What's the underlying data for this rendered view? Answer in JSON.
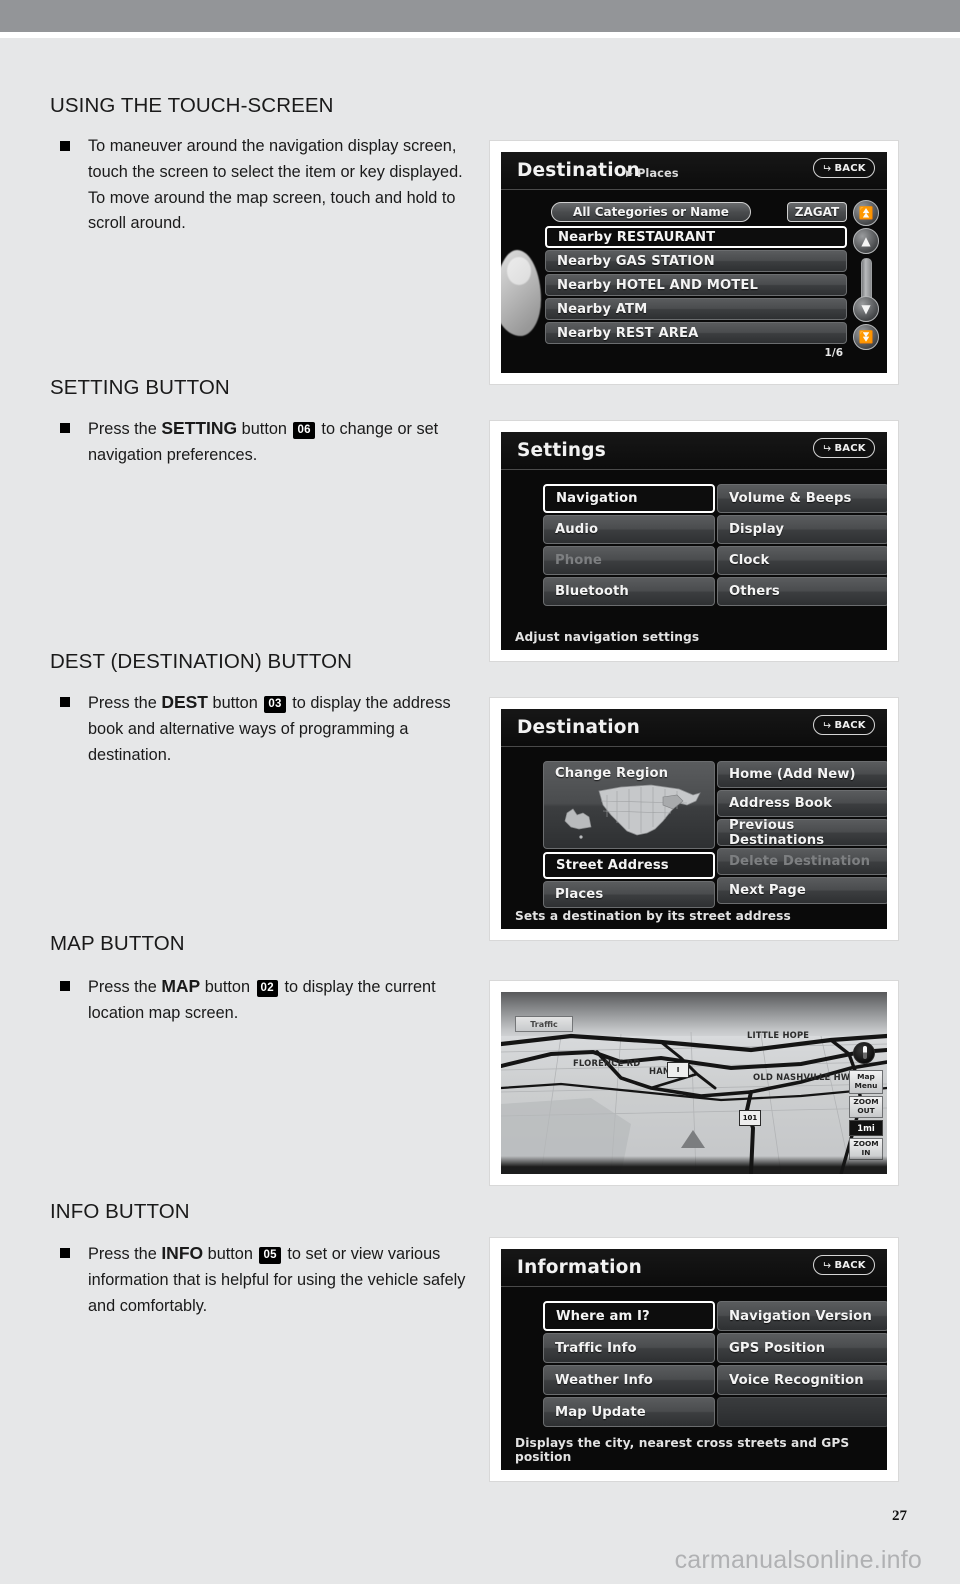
{
  "page": {
    "number": "27",
    "watermark": "carmanualsonline.info"
  },
  "sections": [
    {
      "heading": "USING THE TOUCH-SCREEN",
      "body_pre": "To maneuver around the navigation display screen, touch the screen to select the item or key displayed. To move around the map screen, touch and hold to scroll around.",
      "badge": "",
      "bold": ""
    },
    {
      "heading": "SETTING BUTTON",
      "bold": "SETTING",
      "badge": "06",
      "body_pre": "Press the ",
      "body_mid": " button ",
      "body_post": " to change or set navigation preferences."
    },
    {
      "heading": "DEST (DESTINATION) BUTTON",
      "bold": "DEST",
      "badge": "03",
      "body_pre": "Press the ",
      "body_mid": " button ",
      "body_post": " to display the address book and alternative ways of programming a destination."
    },
    {
      "heading": "MAP BUTTON",
      "bold": "MAP",
      "badge": "02",
      "body_pre": "Press the ",
      "body_mid": " button ",
      "body_post": " to display the current location map screen."
    },
    {
      "heading": "INFO BUTTON",
      "bold": "INFO",
      "badge": "05",
      "body_pre": "Press the ",
      "body_mid": " button ",
      "body_post": " to set or view various information that is helpful for using the vehicle safely and comfortably."
    }
  ],
  "screens": {
    "places": {
      "title": "Destination",
      "breadcrumb": "Places",
      "back_label": "BACK",
      "search_field": "All Categories or Name",
      "zagat_label": "ZAGAT",
      "items": [
        {
          "label": "Nearby RESTAURANT",
          "selected": true
        },
        {
          "label": "Nearby GAS STATION",
          "selected": false
        },
        {
          "label": "Nearby HOTEL AND MOTEL",
          "selected": false
        },
        {
          "label": "Nearby ATM",
          "selected": false
        },
        {
          "label": "Nearby REST AREA",
          "selected": false
        }
      ],
      "page_count": "1/6"
    },
    "settings": {
      "title": "Settings",
      "back_label": "BACK",
      "left_items": [
        {
          "label": "Navigation",
          "selected": true,
          "dim": false
        },
        {
          "label": "Audio",
          "selected": false,
          "dim": false
        },
        {
          "label": "Phone",
          "selected": false,
          "dim": true
        },
        {
          "label": "Bluetooth",
          "selected": false,
          "dim": false
        }
      ],
      "right_items": [
        {
          "label": "Volume & Beeps",
          "selected": false,
          "dim": false
        },
        {
          "label": "Display",
          "selected": false,
          "dim": false
        },
        {
          "label": "Clock",
          "selected": false,
          "dim": false
        },
        {
          "label": "Others",
          "selected": false,
          "dim": false
        }
      ],
      "hint": "Adjust navigation settings"
    },
    "destination": {
      "title": "Destination",
      "back_label": "BACK",
      "change_region_label": "Change Region",
      "left_items": [
        {
          "label": "Street Address",
          "selected": true,
          "dim": false
        },
        {
          "label": "Places",
          "selected": false,
          "dim": false
        }
      ],
      "right_items": [
        {
          "label": "Home (Add New)",
          "selected": false,
          "dim": false
        },
        {
          "label": "Address Book",
          "selected": false,
          "dim": false
        },
        {
          "label": "Previous Destinations",
          "selected": false,
          "dim": false
        },
        {
          "label": "Delete Destination",
          "selected": false,
          "dim": true
        },
        {
          "label": "Next Page",
          "selected": false,
          "dim": false
        }
      ],
      "hint": "Sets a destination by its street address"
    },
    "map": {
      "traffic_label": "Traffic",
      "street_labels": [
        "LITTLE HOPE",
        "FLORENCE RD",
        "HANNA",
        "OLD NASHVILLE HWY"
      ],
      "controls": {
        "map_menu": "Map Menu",
        "zoom_out": "ZOOM OUT",
        "scale": "1mi",
        "zoom_in": "ZOOM IN"
      },
      "sign_labels": [
        "I",
        "101"
      ]
    },
    "information": {
      "title": "Information",
      "back_label": "BACK",
      "left_items": [
        {
          "label": "Where am I?",
          "selected": true,
          "dim": false
        },
        {
          "label": "Traffic Info",
          "selected": false,
          "dim": false
        },
        {
          "label": "Weather Info",
          "selected": false,
          "dim": false
        },
        {
          "label": "Map Update",
          "selected": false,
          "dim": false
        }
      ],
      "right_items": [
        {
          "label": "Navigation Version",
          "selected": false,
          "dim": false
        },
        {
          "label": "GPS Position",
          "selected": false,
          "dim": false
        },
        {
          "label": "Voice Recognition",
          "selected": false,
          "dim": false
        }
      ],
      "hint": "Displays the city, nearest cross streets and GPS position"
    }
  }
}
